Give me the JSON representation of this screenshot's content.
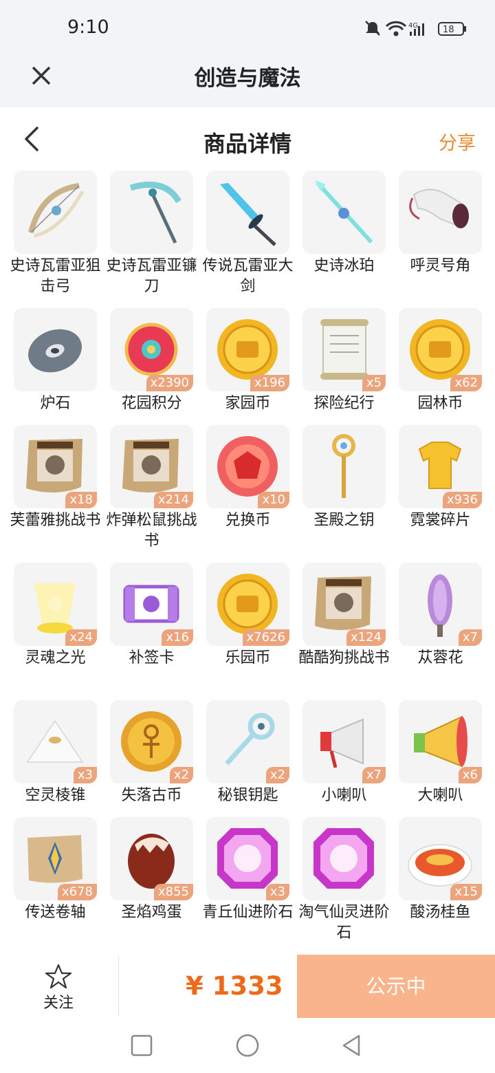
{
  "status": {
    "time": "9:10",
    "battery": "18",
    "network": "4G"
  },
  "app": {
    "title": "创造与魔法"
  },
  "nav": {
    "title": "商品详情",
    "share": "分享"
  },
  "items": [
    {
      "name": "史诗瓦雷亚狙击弓",
      "qty": "",
      "icon": "bow-icon"
    },
    {
      "name": "史诗瓦雷亚镰刀",
      "qty": "",
      "icon": "scythe-icon"
    },
    {
      "name": "传说瓦雷亚大剑",
      "qty": "",
      "icon": "greatsword-icon"
    },
    {
      "name": "史诗冰珀",
      "qty": "",
      "icon": "ice-spear-icon"
    },
    {
      "name": "呼灵号角",
      "qty": "",
      "icon": "horn-icon"
    },
    {
      "name": "炉石",
      "qty": "",
      "icon": "hearthstone-icon"
    },
    {
      "name": "花园积分",
      "qty": "x2390",
      "icon": "flower-badge-icon"
    },
    {
      "name": "家园币",
      "qty": "x196",
      "icon": "gold-coin-icon"
    },
    {
      "name": "探险纪行",
      "qty": "x5",
      "icon": "scroll-icon"
    },
    {
      "name": "园林币",
      "qty": "x62",
      "icon": "gold-coin-icon"
    },
    {
      "name": "芙蕾雅挑战书",
      "qty": "x18",
      "icon": "wanted-poster-icon"
    },
    {
      "name": "炸弹松鼠挑战书",
      "qty": "x214",
      "icon": "wanted-poster-icon"
    },
    {
      "name": "兑换币",
      "qty": "x10",
      "icon": "red-gem-coin-icon"
    },
    {
      "name": "圣殿之钥",
      "qty": "",
      "icon": "golden-key-icon"
    },
    {
      "name": "霓裳碎片",
      "qty": "x936",
      "icon": "shirt-icon"
    },
    {
      "name": "灵魂之光",
      "qty": "x24",
      "icon": "soul-light-icon"
    },
    {
      "name": "补签卡",
      "qty": "x16",
      "icon": "ticket-icon"
    },
    {
      "name": "乐园币",
      "qty": "x7626",
      "icon": "gold-coin-icon"
    },
    {
      "name": "酷酷狗挑战书",
      "qty": "x124",
      "icon": "wanted-poster-icon"
    },
    {
      "name": "苁蓉花",
      "qty": "x7",
      "icon": "purple-flower-icon"
    },
    {
      "name": "空灵棱锥",
      "qty": "x3",
      "icon": "pyramid-icon"
    },
    {
      "name": "失落古币",
      "qty": "x2",
      "icon": "ankh-coin-icon"
    },
    {
      "name": "秘银钥匙",
      "qty": "x2",
      "icon": "silver-key-icon"
    },
    {
      "name": "小喇叭",
      "qty": "x7",
      "icon": "megaphone-icon"
    },
    {
      "name": "大喇叭",
      "qty": "x6",
      "icon": "big-megaphone-icon"
    },
    {
      "name": "传送卷轴",
      "qty": "x678",
      "icon": "teleport-scroll-icon"
    },
    {
      "name": "圣焰鸡蛋",
      "qty": "x855",
      "icon": "egg-icon"
    },
    {
      "name": "青丘仙进阶石",
      "qty": "x3",
      "icon": "pink-gem-icon"
    },
    {
      "name": "淘气仙灵进阶石",
      "qty": "",
      "icon": "pink-gem-icon"
    },
    {
      "name": "酸汤桂鱼",
      "qty": "x15",
      "icon": "fish-soup-icon"
    }
  ],
  "bottom": {
    "follow": "关注",
    "price": "¥ 1333",
    "status": "公示中"
  }
}
